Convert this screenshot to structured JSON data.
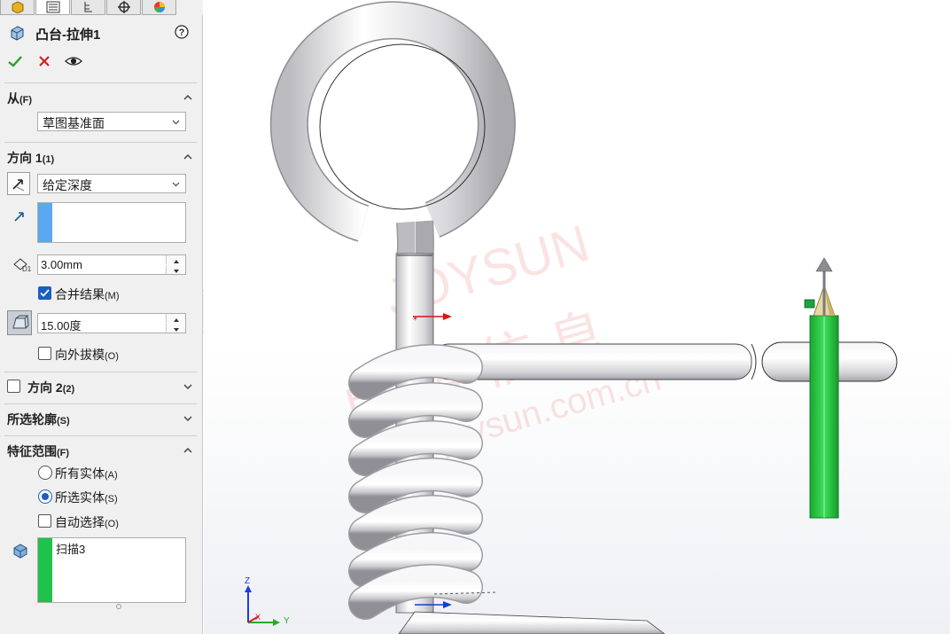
{
  "feature": {
    "title": "凸台-拉伸1",
    "help_icon": "help-icon",
    "ok_icon": "checkmark-icon",
    "cancel_icon": "close-icon",
    "preview_icon": "eye-icon"
  },
  "tabs": [
    "feature-manager",
    "property-manager",
    "configuration-manager",
    "dimxpert-manager",
    "display-manager"
  ],
  "from": {
    "title": "从",
    "shortcut": "(F)",
    "selected": "草图基准面"
  },
  "direction1": {
    "title": "方向 1",
    "shortcut": "(1)",
    "end_condition": "给定深度",
    "depth": "3.00mm",
    "merge_result": {
      "label": "合并结果",
      "shortcut": "(M)",
      "checked": true
    },
    "draft_angle": "15.00度",
    "draft_outward": {
      "label": "向外拔模",
      "shortcut": "(O)",
      "checked": false
    }
  },
  "direction2": {
    "title": "方向 2",
    "shortcut": "(2)",
    "checked": false
  },
  "selected_contours": {
    "title": "所选轮廓",
    "shortcut": "(S)"
  },
  "feature_scope": {
    "title": "特征范围",
    "shortcut": "(F)",
    "all_bodies": {
      "label": "所有实体",
      "shortcut": "(A)",
      "selected": false
    },
    "selected_bodies": {
      "label": "所选实体",
      "shortcut": "(S)",
      "selected": true
    },
    "auto_select": {
      "label": "自动选择",
      "shortcut": "(O)",
      "checked": false
    },
    "bodies": [
      "扫描3"
    ]
  },
  "triad": {
    "z": "Z",
    "x": "X",
    "y": "Y"
  },
  "colors": {
    "accent_blue": "#1a5ebf",
    "selection_blue": "#5aa8f0",
    "selection_green": "#1fc24a",
    "model_gray": "#e4e4e6",
    "extrude_green": "#22c03c"
  }
}
